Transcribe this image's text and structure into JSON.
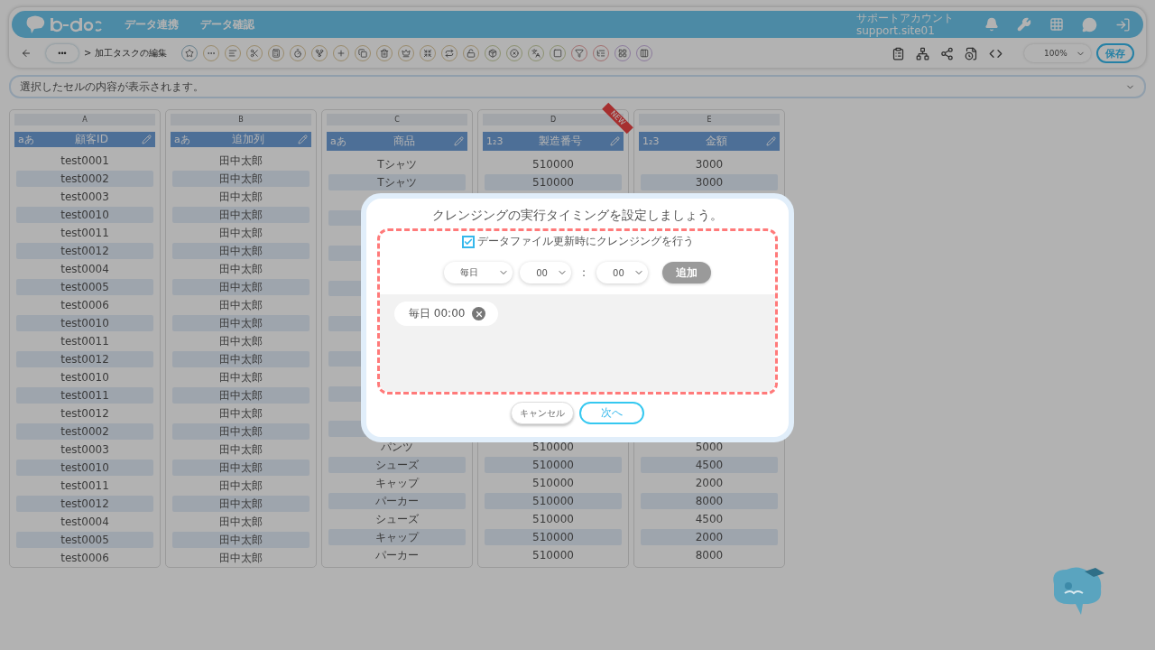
{
  "header": {
    "nav": [
      "データ連携",
      "データ確認"
    ],
    "account": {
      "name": "サポートアカウント",
      "id": "support.site01"
    }
  },
  "toolbar": {
    "menu_button": "•••",
    "breadcrumb": "> 加工タスクの編集",
    "zoom": "100%",
    "save": "保存"
  },
  "cell_bar": {
    "placeholder": "選択したセルの内容が表示されます。"
  },
  "table": {
    "columns": [
      {
        "letter": "A",
        "type": "aあ",
        "name": "顧客ID"
      },
      {
        "letter": "B",
        "type": "aあ",
        "name": "追加列"
      },
      {
        "letter": "C",
        "type": "aあ",
        "name": "商品"
      },
      {
        "letter": "D",
        "type": "1₂3",
        "name": "製造番号",
        "badge": "NEW"
      },
      {
        "letter": "E",
        "type": "1₂3",
        "name": "金額"
      }
    ],
    "rows": [
      [
        "test0001",
        "田中太郎",
        "Tシャツ",
        "510000",
        "3000"
      ],
      [
        "test0002",
        "田中太郎",
        "Tシャツ",
        "510000",
        "3000"
      ],
      [
        "test0003",
        "田中太郎",
        null,
        null,
        null
      ],
      [
        "test0010",
        "田中太郎",
        null,
        null,
        null
      ],
      [
        "test0011",
        "田中太郎",
        null,
        null,
        null
      ],
      [
        "test0012",
        "田中太郎",
        null,
        null,
        null
      ],
      [
        "test0004",
        "田中太郎",
        null,
        null,
        null
      ],
      [
        "test0005",
        "田中太郎",
        null,
        null,
        null
      ],
      [
        "test0006",
        "田中太郎",
        null,
        null,
        null
      ],
      [
        "test0010",
        "田中太郎",
        null,
        null,
        null
      ],
      [
        "test0011",
        "田中太郎",
        null,
        null,
        null
      ],
      [
        "test0012",
        "田中太郎",
        null,
        null,
        null
      ],
      [
        "test0010",
        "田中太郎",
        null,
        null,
        null
      ],
      [
        "test0011",
        "田中太郎",
        null,
        null,
        null
      ],
      [
        "test0012",
        "田中太郎",
        null,
        null,
        null
      ],
      [
        "test0002",
        "田中太郎",
        null,
        null,
        null
      ],
      [
        "test0003",
        "田中太郎",
        "パンツ",
        "510000",
        "5000"
      ],
      [
        "test0010",
        "田中太郎",
        "シューズ",
        "510000",
        "4500"
      ],
      [
        "test0011",
        "田中太郎",
        "キャップ",
        "510000",
        "2000"
      ],
      [
        "test0012",
        "田中太郎",
        "パーカー",
        "510000",
        "8000"
      ],
      [
        "test0004",
        "田中太郎",
        "シューズ",
        "510000",
        "4500"
      ],
      [
        "test0005",
        "田中太郎",
        "キャップ",
        "510000",
        "2000"
      ],
      [
        "test0006",
        "田中太郎",
        "パーカー",
        "510000",
        "8000"
      ]
    ]
  },
  "dialog": {
    "title": "クレンジングの実行タイミングを設定しましょう。",
    "checkbox": {
      "label": "データファイル更新時にクレンジングを行う",
      "checked": true
    },
    "selects": [
      {
        "value": "毎日"
      },
      {
        "value": "00"
      },
      {
        "value": "00"
      }
    ],
    "separator": ":",
    "add_button": {
      "label": "追加",
      "disabled": true
    },
    "schedules": [
      "毎日 00:00"
    ],
    "buttons": [
      {
        "label": "キャンセル",
        "kind": "secondary"
      },
      {
        "label": "次へ",
        "kind": "primary"
      }
    ]
  }
}
